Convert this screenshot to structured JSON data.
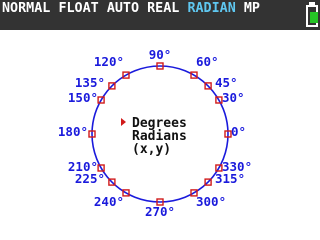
{
  "status_bar": {
    "mode_normal": "NORMAL",
    "mode_float": "FLOAT",
    "mode_auto": "AUTO",
    "mode_real": "REAL",
    "mode_angle": "RADIAN",
    "mode_mp": "MP",
    "battery_level": 0.6,
    "colors": {
      "background": "#333333",
      "text": "#ffffff",
      "highlight": "#5fc7f0",
      "battery": "#26c426"
    }
  },
  "unit_circle": {
    "circle_color": "#1a1adc",
    "marker_color": "#d11a1a",
    "angles": [
      {
        "deg": 90,
        "label": "90°"
      },
      {
        "deg": 60,
        "label": "60°"
      },
      {
        "deg": 45,
        "label": "45°"
      },
      {
        "deg": 30,
        "label": "30°"
      },
      {
        "deg": 0,
        "label": "0°"
      },
      {
        "deg": 330,
        "label": "330°"
      },
      {
        "deg": 315,
        "label": "315°"
      },
      {
        "deg": 300,
        "label": "300°"
      },
      {
        "deg": 270,
        "label": "270°"
      },
      {
        "deg": 240,
        "label": "240°"
      },
      {
        "deg": 225,
        "label": "225°"
      },
      {
        "deg": 210,
        "label": "210°"
      },
      {
        "deg": 180,
        "label": "180°"
      },
      {
        "deg": 150,
        "label": "150°"
      },
      {
        "deg": 135,
        "label": "135°"
      },
      {
        "deg": 120,
        "label": "120°"
      }
    ]
  },
  "menu": {
    "selected_index": 0,
    "items": [
      "Degrees",
      "Radians",
      "(x,y)"
    ]
  }
}
